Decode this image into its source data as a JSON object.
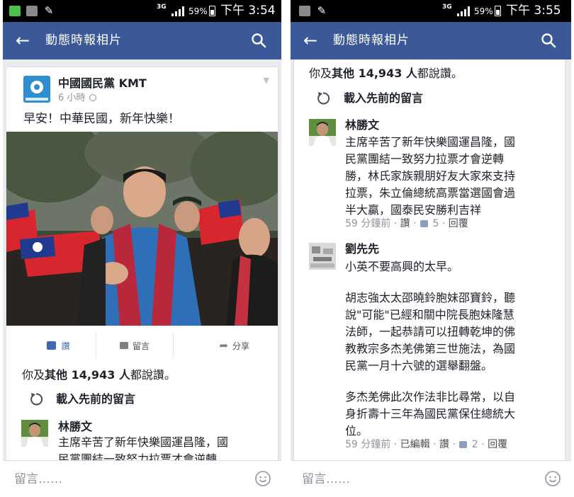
{
  "statusbar": {
    "left": {
      "network": "3G",
      "battery": "59%",
      "time": "下午 3:54"
    },
    "right": {
      "network": "3G",
      "battery": "59%",
      "time": "下午 3:55"
    }
  },
  "appbar": {
    "title": "動態時報相片"
  },
  "post": {
    "page_name": "中國國民黨 KMT",
    "time": "6 小時",
    "text": "早安！中華民國，新年快樂！",
    "actions": {
      "like": "讚",
      "comment": "留言",
      "share": "分享"
    }
  },
  "likes": {
    "prefix": "你及",
    "bold": "其他 14,943 人",
    "suffix": "都說讚。"
  },
  "load_previous": "載入先前的留言",
  "comments": [
    {
      "name": "林勝文",
      "text": "主席辛苦了新年快樂國運昌隆，國民黨團結一致努力拉票才會逆轉勝，林氏家族親朋好友大家來支持拉票，朱立倫總統高票當選國會過半大贏，國泰民安勝利吉祥",
      "text_lines": [
        "主席辛苦了新年快樂國運昌隆，國",
        "民黨團結一致努力拉票才會逆轉",
        "勝，林氏家族親朋好友大家來支持",
        "拉票，朱立倫總統高票當選國會過",
        "半大贏，國泰民安勝利吉祥"
      ],
      "time": "59 分鐘前",
      "like": "讚",
      "likes": "5",
      "reply": "回覆"
    },
    {
      "name": "劉先先",
      "text_lines": [
        "小英不要高興的太早。",
        "",
        "胡志強太太邵曉鈴胞妹邵寶鈴，聽",
        "說\"可能\"已經和關中院長胞妹隆慧",
        "法師，一起恭請可以扭轉乾坤的佛",
        "教教宗多杰羌佛第三世施法，為國",
        "民黨一月十六號的選舉翻盤。",
        "",
        "多杰羌佛此次作法非比尋常，以自",
        "身折壽十三年為國民黨保住總統大",
        "位。"
      ],
      "time": "59 分鐘前",
      "edited": "已編輯",
      "like": "讚",
      "likes": "2",
      "reply": "回覆"
    }
  ],
  "composer": {
    "placeholder": "留言……"
  },
  "colors": {
    "brand": "#3b5998",
    "like_blue": "#4267b2",
    "meta_gray": "#90949c"
  }
}
